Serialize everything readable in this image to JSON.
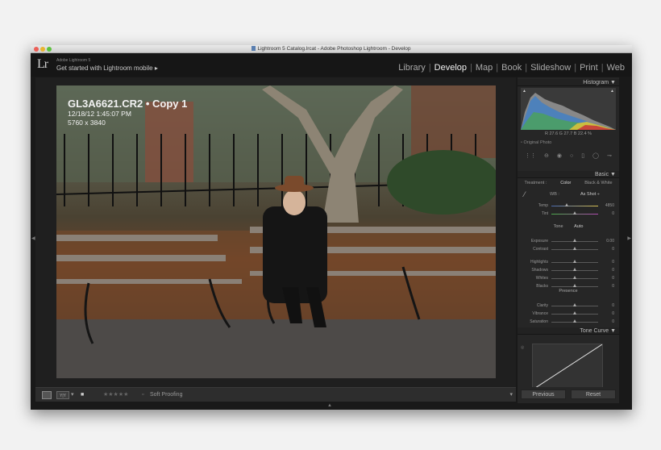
{
  "window": {
    "title": "Lightroom 5 Catalog.lrcat - Adobe Photoshop Lightroom - Develop"
  },
  "identity": {
    "logo": "Lr",
    "product": "Adobe Lightroom 5",
    "mobile_text": "Get started with Lightroom mobile ▸"
  },
  "modules": [
    "Library",
    "Develop",
    "Map",
    "Book",
    "Slideshow",
    "Print",
    "Web"
  ],
  "active_module": "Develop",
  "photo_info": {
    "filename": "GL3A6621.CR2 • Copy 1",
    "datetime": "12/18/12 1:45:07 PM",
    "dimensions": "5760 x 3840"
  },
  "histogram": {
    "header": "Histogram ▼",
    "readout": "R 27.6  G 27.7  B 22.4 %",
    "original_photo": "Original Photo"
  },
  "basic": {
    "header": "Basic ▼",
    "treatment_label": "Treatment :",
    "color_tab": "Color",
    "bw_tab": "Black & White",
    "wb_label": "WB :",
    "wb_value": "As Shot ÷",
    "tone_label": "Tone",
    "auto_label": "Auto",
    "presence_label": "Presence",
    "sliders": [
      {
        "label": "Temp",
        "value": "4850",
        "pos": 0.34
      },
      {
        "label": "Tint",
        "value": "0",
        "pos": 0.5
      },
      {
        "label": "Exposure",
        "value": "0.00",
        "pos": 0.5
      },
      {
        "label": "Contrast",
        "value": "0",
        "pos": 0.5
      },
      {
        "label": "Highlights",
        "value": "0",
        "pos": 0.5
      },
      {
        "label": "Shadows",
        "value": "0",
        "pos": 0.5
      },
      {
        "label": "Whites",
        "value": "0",
        "pos": 0.5
      },
      {
        "label": "Blacks",
        "value": "0",
        "pos": 0.5
      },
      {
        "label": "Clarity",
        "value": "0",
        "pos": 0.5
      },
      {
        "label": "Vibrance",
        "value": "0",
        "pos": 0.5
      },
      {
        "label": "Saturation",
        "value": "0",
        "pos": 0.5
      }
    ]
  },
  "tone_curve": {
    "header": "Tone Curve ▼"
  },
  "toolbar": {
    "soft_proofing": "Soft Proofing",
    "rating": "★★★★★"
  },
  "buttons": {
    "previous": "Previous",
    "reset": "Reset"
  },
  "colors": {
    "panel_bg": "#262626",
    "app_bg": "#191919",
    "accent_text": "#f0f0f0"
  }
}
